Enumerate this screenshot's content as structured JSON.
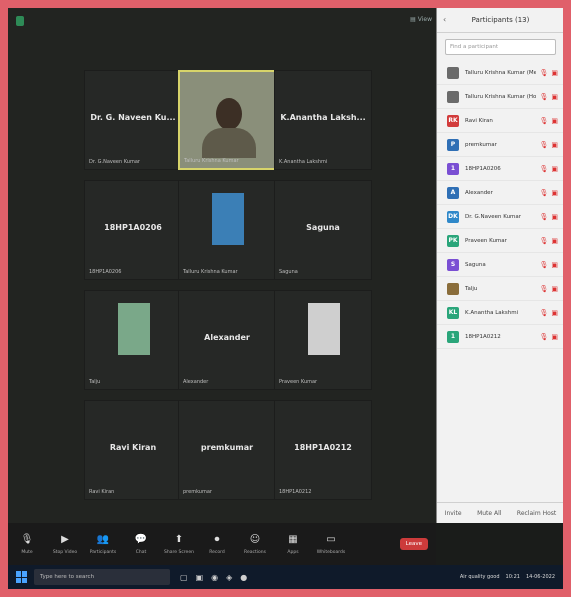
{
  "window": {
    "participants_title": "Participants (13)",
    "search_placeholder": "Find a participant"
  },
  "tiles": [
    {
      "name": "Dr. G. Naveen Ku...",
      "caption": "Dr. G.Naveen Kumar",
      "type": "name"
    },
    {
      "name": "",
      "caption": "Talluru Krishna Kumar",
      "type": "video"
    },
    {
      "name": "K.Anantha  Laksh...",
      "caption": "K.Anantha Lakshmi",
      "type": "name"
    },
    {
      "name": "18HP1A0206",
      "caption": "18HP1A0206",
      "type": "name"
    },
    {
      "name": "",
      "caption": "Talluru Krishna Kumar",
      "type": "thumb"
    },
    {
      "name": "Saguna",
      "caption": "Saguna",
      "type": "name"
    },
    {
      "name": "",
      "caption": "Talju",
      "type": "thumb"
    },
    {
      "name": "Alexander",
      "caption": "Alexander",
      "type": "name"
    },
    {
      "name": "",
      "caption": "Praveen Kumar",
      "type": "thumb"
    },
    {
      "name": "Ravi Kiran",
      "caption": "Ravi Kiran",
      "type": "name"
    },
    {
      "name": "premkumar",
      "caption": "premkumar",
      "type": "name"
    },
    {
      "name": "18HP1A0212",
      "caption": "18HP1A0212",
      "type": "name"
    }
  ],
  "participants": [
    {
      "name": "Talluru Krishna Kumar (Me)",
      "initial": "",
      "color": "#6b6b6b"
    },
    {
      "name": "Talluru Krishna Kumar (Host)",
      "initial": "",
      "color": "#6b6b6b"
    },
    {
      "name": "Ravi Kiran",
      "initial": "RK",
      "color": "#d23b3b"
    },
    {
      "name": "premkumar",
      "initial": "P",
      "color": "#2f6fb5"
    },
    {
      "name": "18HP1A0206",
      "initial": "1",
      "color": "#7a4fd3"
    },
    {
      "name": "Alexander",
      "initial": "A",
      "color": "#2f6fb5"
    },
    {
      "name": "Dr. G.Naveen Kumar",
      "initial": "DK",
      "color": "#2f88c9"
    },
    {
      "name": "Praveen Kumar",
      "initial": "PK",
      "color": "#2aa57a"
    },
    {
      "name": "Saguna",
      "initial": "S",
      "color": "#7a4fd3"
    },
    {
      "name": "Talju",
      "initial": "",
      "color": "#8a6d3b"
    },
    {
      "name": "K.Anantha Lakshmi",
      "initial": "KL",
      "color": "#2aa57a"
    },
    {
      "name": "18HP1A0212",
      "initial": "1",
      "color": "#2aa57a"
    }
  ],
  "panel_footer": {
    "invite": "Invite",
    "mute_all": "Mute All",
    "reclaim_host": "Reclaim Host"
  },
  "toolbar": [
    {
      "label": "Mute",
      "icon": "mic-icon"
    },
    {
      "label": "Stop Video",
      "icon": "video-icon"
    },
    {
      "label": "Participants",
      "icon": "participants-icon"
    },
    {
      "label": "Chat",
      "icon": "chat-icon"
    },
    {
      "label": "Share Screen",
      "icon": "share-icon"
    },
    {
      "label": "Record",
      "icon": "record-icon"
    },
    {
      "label": "Reactions",
      "icon": "reactions-icon"
    },
    {
      "label": "Apps",
      "icon": "apps-icon"
    },
    {
      "label": "Whiteboards",
      "icon": "whiteboard-icon"
    }
  ],
  "leave_label": "Leave",
  "taskbar": {
    "search_placeholder": "Type here to search",
    "air_quality": "Air quality good",
    "time": "10:21",
    "date": "14-06-2022"
  }
}
